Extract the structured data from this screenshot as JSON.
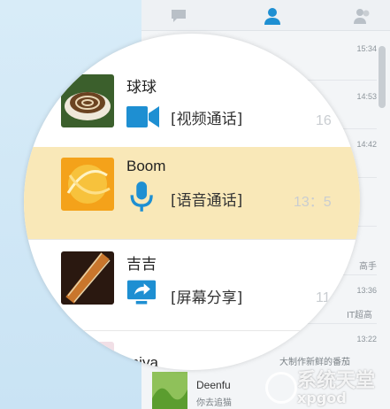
{
  "times": [
    "15:34",
    "14:53",
    "14:42",
    "13:36",
    "13:22"
  ],
  "partial_texts": {
    "right_1": "16",
    "right_2": "13：5",
    "right_3": "11",
    "right_4": "高手",
    "right_5": "IT超高",
    "right_6": "大制作新鲜的番茄",
    "right_7": "你去追猫"
  },
  "contacts": [
    {
      "name": "球球",
      "call": "[视频通话]",
      "call_icon": "video-camera-icon"
    },
    {
      "name": "Boom",
      "call": "[语音通话]",
      "call_icon": "microphone-icon"
    },
    {
      "name": "吉吉",
      "call": "[屏幕分享]",
      "call_icon": "screen-share-icon"
    },
    {
      "name": "miya",
      "call": "",
      "call_icon": ""
    }
  ],
  "bottom_contact": {
    "name": "Deenfu"
  },
  "watermark": {
    "main": "系统天堂",
    "sub": "xpgod"
  },
  "colors": {
    "accent": "#1e8fd2",
    "highlight": "#f9e8b8"
  }
}
